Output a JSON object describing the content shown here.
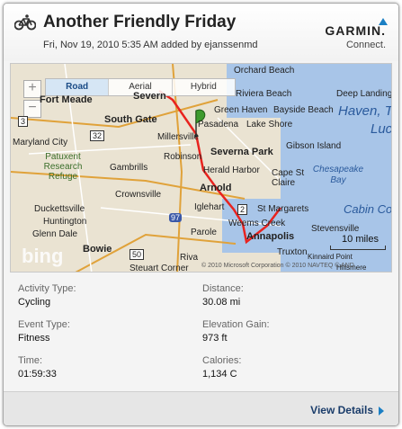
{
  "header": {
    "title": "Another Friendly Friday",
    "subtitle": "Fri, Nov 19, 2010 5:35 AM added by ejanssenmd",
    "brand": "GARMIN.",
    "brand_sub": "Connect."
  },
  "map": {
    "types": [
      "Road",
      "Aerial",
      "Hybrid"
    ],
    "selected_type": "Road",
    "labels": [
      "Severn",
      "Orchard Beach",
      "Riviera Beach",
      "Deep Landing",
      "Fort Meade",
      "Green Haven",
      "Bayside Beach",
      "Haven, Th",
      "South Gate",
      "Pasadena",
      "Lake Shore",
      "Lucy",
      "Millersville",
      "Severna Park",
      "Gibson Island",
      "Maryland City",
      "Patuxent Research Refuge",
      "Gambrills",
      "Robinson",
      "Herald Harbor",
      "Chesapeake Bay",
      "Cape St Claire",
      "Crownsville",
      "Arnold",
      "Duckettsville",
      "Huntington",
      "Iglehart",
      "St Margarets",
      "Cabin Co",
      "Glenn Dale",
      "Weems Creek",
      "Stevensville",
      "Bowie",
      "Parole",
      "Annapolis",
      "Steuart Corner",
      "Riva",
      "Truxton",
      "Kinnaird Point",
      "Hillsmere"
    ],
    "road_shields": [
      "32",
      "3",
      "97",
      "50",
      "2"
    ],
    "scale_label": "10 miles",
    "copyright": "© 2010 Microsoft Corporation © 2010 NAVTEQ © AND",
    "logo": "bing",
    "zoom_in": "+",
    "zoom_out": "−"
  },
  "stats": [
    {
      "label": "Activity Type:",
      "value": "Cycling"
    },
    {
      "label": "Distance:",
      "value": "30.08 mi"
    },
    {
      "label": "Event Type:",
      "value": "Fitness"
    },
    {
      "label": "Elevation Gain:",
      "value": "973 ft"
    },
    {
      "label": "Time:",
      "value": "01:59:33"
    },
    {
      "label": "Calories:",
      "value": "1,134 C"
    }
  ],
  "footer": {
    "view_details": "View Details"
  },
  "colors": {
    "route": "#e8231f",
    "accent": "#1b7fc4",
    "water": "#a8c5e8",
    "land": "#eae3d2"
  }
}
